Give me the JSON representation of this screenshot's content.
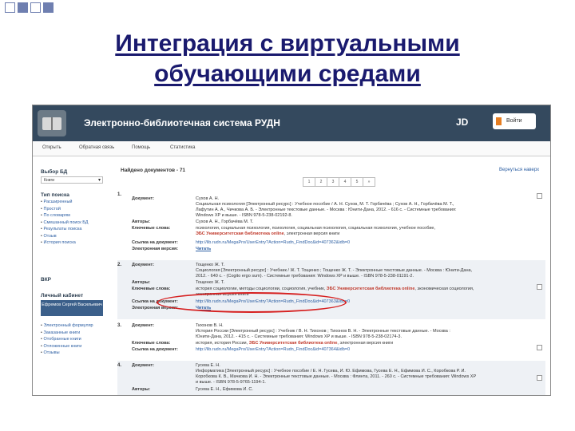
{
  "slide": {
    "title_line1": "Интеграция с виртуальными",
    "title_line2": "обучающими средами"
  },
  "app": {
    "title": "Электронно-библиотечная система РУДН",
    "brand_mark": "JD",
    "login_label": "Войти"
  },
  "nav": [
    "Открыть",
    "Обратная связь",
    "Помощь",
    "Статистика"
  ],
  "sidebar": {
    "db_heading": "Выбор БД",
    "db_value": "Книги",
    "search_heading": "Тип поиска",
    "search_items": [
      "Расширенный",
      "Простой",
      "По словарям",
      "Смешанный поиск БД",
      "Результаты поиска",
      "Отзыв",
      "История поиска"
    ],
    "vkr": "ВКР",
    "cabinet_heading": "Личный кабинет",
    "user_name": "Ефремов Сергей Васильевич",
    "cabinet_items": [
      "Электронный формуляр",
      "Заказанные книги",
      "Отобранные книги",
      "Отложенные книги",
      "Отзывы"
    ]
  },
  "results": {
    "found": "Найдено документов - 71",
    "pages": [
      "1",
      "2",
      "3",
      "4",
      "5",
      "»"
    ],
    "top_link": "Вернуться наверх"
  },
  "labels": {
    "doc": "Документ:",
    "authors": "Авторы:",
    "keywords": "Ключевые слова:",
    "doc_link": "Ссылка на документ:",
    "eversion": "Электронная версия:",
    "read": "Читать"
  },
  "records": [
    {
      "num": "1.",
      "doc1": "Сухов А. Н.",
      "doc2": "Социальная психология [Электронный ресурс] : Учебное пособие / А. Н. Сухов, М. Т. Горбачёва ; Сухов А. Н., Горбачёва М. Т.,",
      "doc3": "Лафутин А. А., Чичкова А. Б. - Электронные текстовые данные. - Москва : Юнити-Дана, 2012. - 616 с. - Системные требования:",
      "doc4": "Windows XP и выше. - ISBN 978-5-238-02192-8.",
      "authors": "Сухов А. Н., Горбачёва М. Т.",
      "kw1": "психология, социальная психология, психология, социальная психология, социальная психология, учебное пособие,",
      "kw_red": "ЭБС Университетская библиотека online",
      "kw2": ", электронная версия книги",
      "link": "http://lib.rudn.ru/MegaPro/UserEntry?Action=Rudn_FindDoc&id=407362&idb=0"
    },
    {
      "num": "2.",
      "doc1": "Тощенко Ж. Т.",
      "doc2": "Социология [Электронный ресурс] : Учебник / Ж. Т. Тощенко ; Тощенко Ж. Т. - Электронные текстовые данные. - Москва : Юнити-Дана,",
      "doc3": "2012. - 640 с. - (Cogito ergo sum). - Системные требования: Windows XP и выше. - ISBN 978-5-238-01191-2.",
      "authors": "Тощенко Ж. Т.",
      "kw_pre": "история социологии, методы социологии, социология, учебник,",
      "kw_red": "ЭБС Университетская библиотека online",
      "kw2": ", экономическая социология,",
      "kw3": "электронная версия книги",
      "link": "http://lib.rudn.ru/MegaPro/UserEntry?Action=Rudn_FindDoc&id=407363&idb=0"
    },
    {
      "num": "3.",
      "doc1": "Тихонов В. Н.",
      "doc2": "История России [Электронный ресурс] : Учебник / В. Н. Тихонов ; Тихонов В. Н. - Электронные текстовые данные. - Москва :",
      "doc3": "Юнити-Дана, 2012. - 415 с. - Системные требования: Windows XP и выше. - ISBN 978-5-238-02174-3.",
      "kw1": "история, история России,",
      "kw_red": "ЭБС Университетская библиотека online",
      "kw2": ", электронная версия книги",
      "link": "http://lib.rudn.ru/MegaPro/UserEntry?Action=Rudn_FindDoc&id=407364&idb=0"
    },
    {
      "num": "4.",
      "doc1": "Гусева Е. Н.",
      "doc2": "Информатика [Электронный ресурс] : Учебное пособие / Е. Н. Гусева, И. Ю. Ефимова, Гусева Е. Н., Ефимова И. С., Коробкова Р. И.",
      "doc3": "Коробкова К. В., Мачкова И. Н. - Электронные текстовые данные. - Москва : Флинта, 2011. - 260 с. - Системные требования: Windows XP",
      "doc4": "и выше. - ISBN 978-5-9765-1194-1.",
      "authors": "Гусева Е. Н., Ефимова И. С."
    }
  ]
}
